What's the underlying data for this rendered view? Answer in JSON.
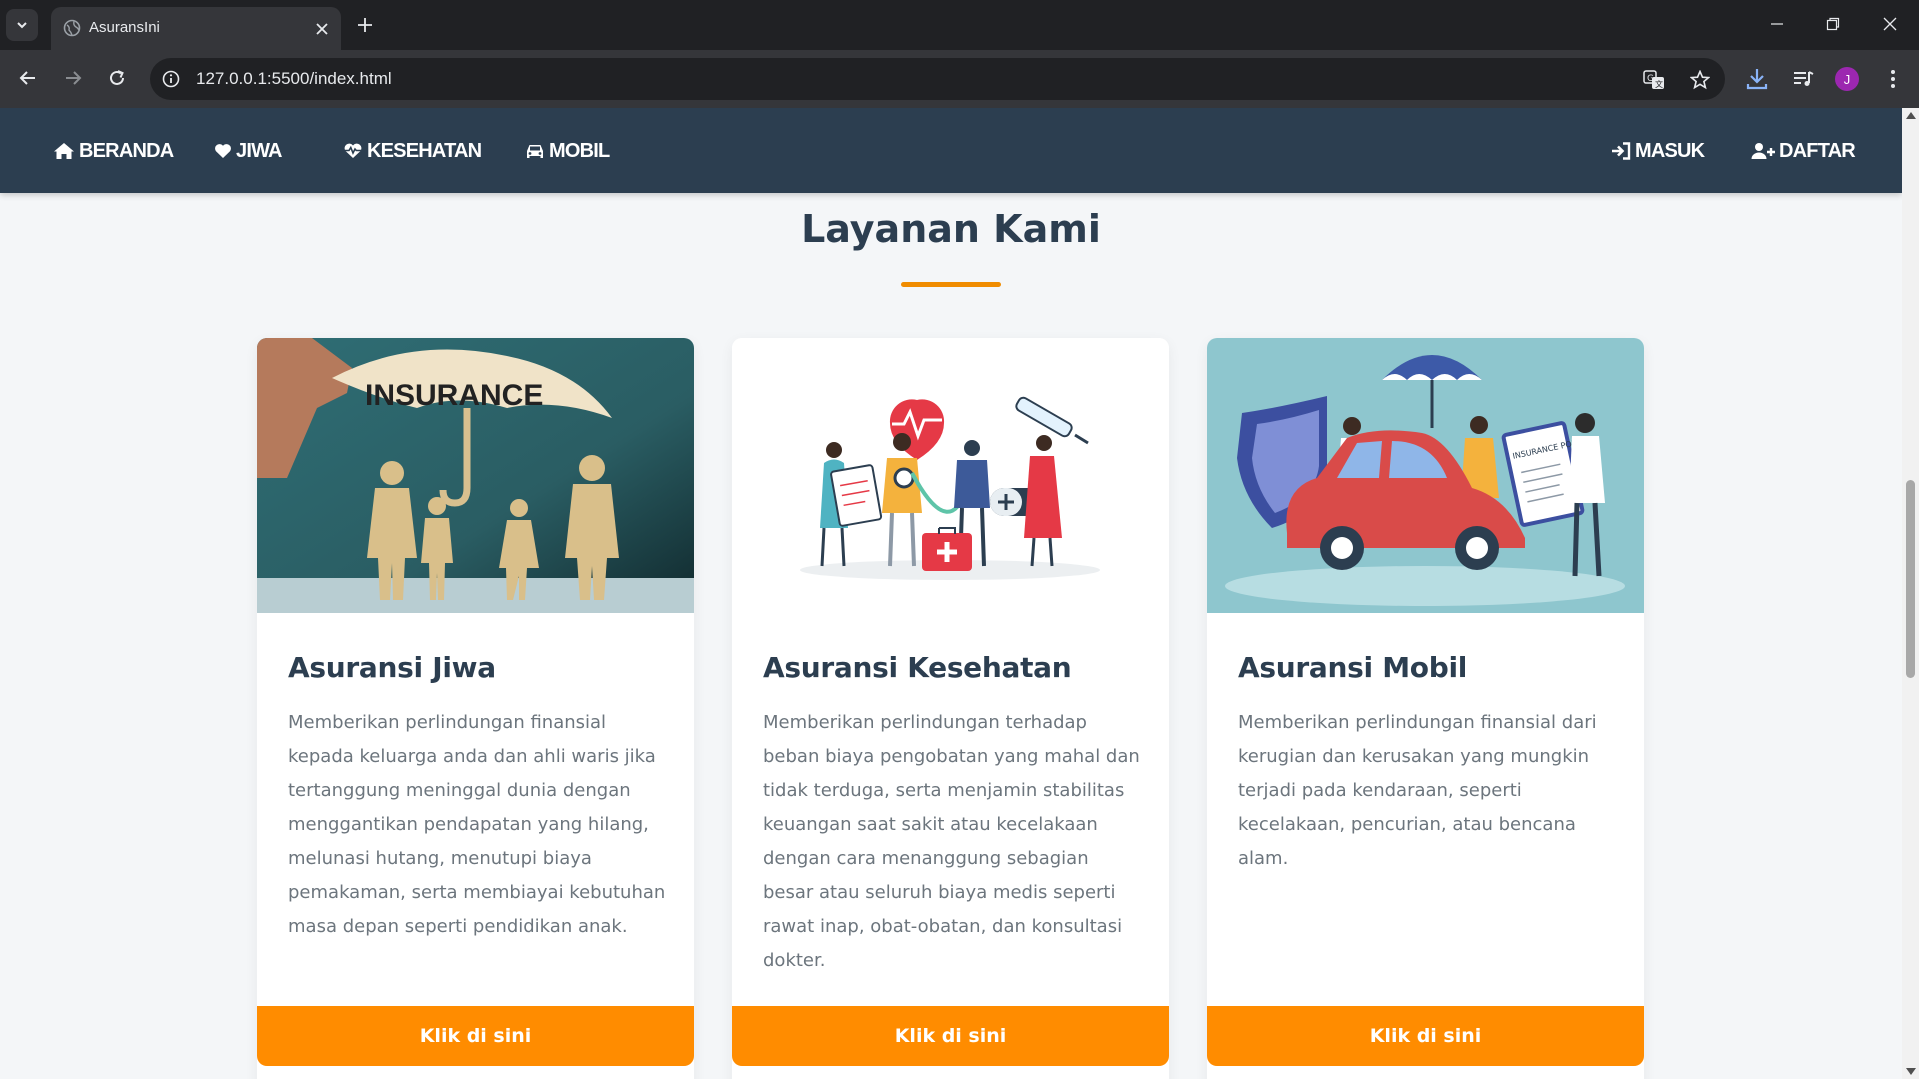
{
  "browser": {
    "tab_title": "AsuransIni",
    "url": "127.0.0.1:5500/index.html",
    "profile_initial": "J"
  },
  "navbar": {
    "left_links": [
      {
        "label": "BERANDA",
        "icon": "home-icon"
      },
      {
        "label": "JIWA",
        "icon": "heart-icon"
      },
      {
        "label": "KESEHATAN",
        "icon": "heart-pulse-icon"
      },
      {
        "label": "MOBIL",
        "icon": "car-icon"
      }
    ],
    "right_links": [
      {
        "label": "MASUK",
        "icon": "sign-in-icon"
      },
      {
        "label": "DAFTAR",
        "icon": "user-plus-icon"
      }
    ]
  },
  "section": {
    "title": "Layanan Kami"
  },
  "cards": [
    {
      "title": "Asuransi Jiwa",
      "image_text": "INSURANCE",
      "description": "Memberikan perlindungan finansial kepada keluarga anda dan ahli waris jika tertanggung meninggal dunia dengan menggantikan pendapatan yang hilang, melunasi hutang, menutupi biaya pemakaman, serta membiayai kebutuhan masa depan seperti pendidikan anak.",
      "button": "Klik di sini"
    },
    {
      "title": "Asuransi Kesehatan",
      "description": "Memberikan perlindungan terhadap beban biaya pengobatan yang mahal dan tidak terduga, serta menjamin stabilitas keuangan saat sakit atau kecelakaan dengan cara menanggung sebagian besar atau seluruh biaya medis seperti rawat inap, obat-obatan, dan konsultasi dokter.",
      "button": "Klik di sini"
    },
    {
      "title": "Asuransi Mobil",
      "image_text": "INSURANCE POLICY",
      "description": "Memberikan perlindungan finansial dari kerugian dan kerusakan yang mungkin terjadi pada kendaraan, seperti kecelakaan, pencurian, atau bencana alam.",
      "button": "Klik di sini"
    }
  ],
  "colors": {
    "navbar_bg": "#2c3e50",
    "accent": "#ff8c00",
    "page_bg": "#f4f6f8",
    "heading": "#2c3e50",
    "body_text": "#6c757d"
  }
}
